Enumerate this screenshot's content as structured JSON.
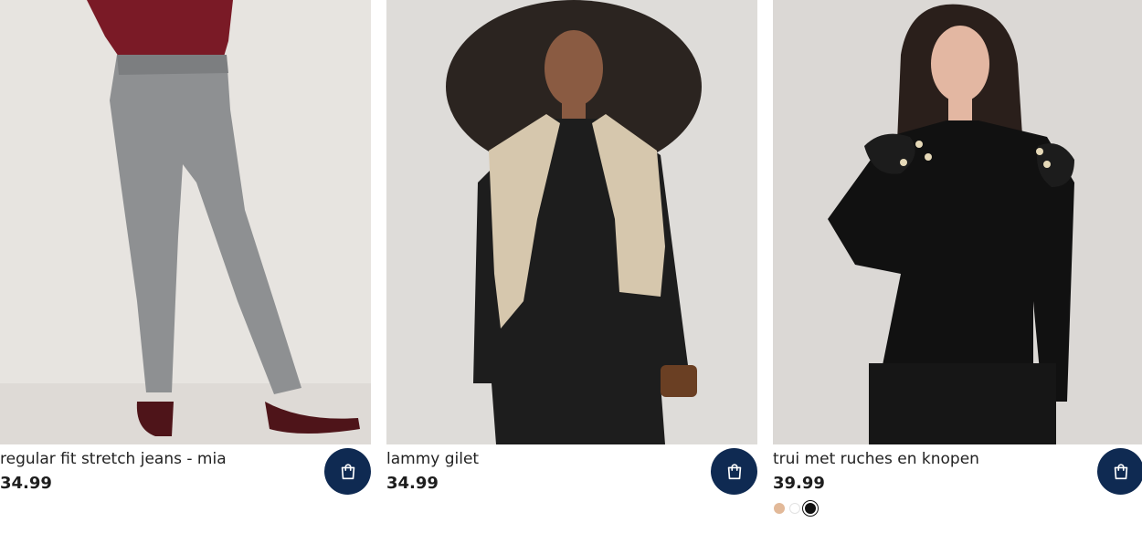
{
  "products": [
    {
      "name": "regular fit stretch jeans - mia",
      "price": "34.99",
      "photo_background": "#e4e1dd",
      "swatches": []
    },
    {
      "name": "lammy gilet",
      "price": "34.99",
      "photo_background": "#dcdad7",
      "swatches": []
    },
    {
      "name": "trui met ruches en knopen",
      "price": "39.99",
      "photo_background": "#d9d6d3",
      "swatches": [
        {
          "color": "#e2b999",
          "selected": false
        },
        {
          "color": "#ffffff",
          "selected": false
        },
        {
          "color": "#111111",
          "selected": true
        }
      ]
    }
  ],
  "cart_button": {
    "icon": "shopping-bag-icon",
    "background": "#0f2a52"
  }
}
